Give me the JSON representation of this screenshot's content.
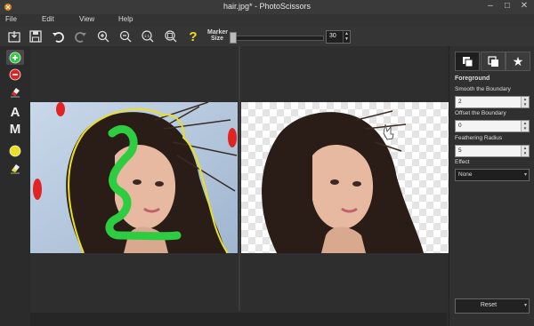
{
  "window": {
    "title": "hair.jpg* - PhotoScissors",
    "minimize": "–",
    "maximize": "□",
    "close": "✕"
  },
  "menu": [
    "File",
    "Edit",
    "View",
    "Help"
  ],
  "toolbar": {
    "icons": [
      "open-icon",
      "save-icon",
      "undo-icon",
      "redo-icon",
      "zoom-in-icon",
      "zoom-out-icon",
      "actual-size-icon",
      "fit-icon",
      "help-icon"
    ],
    "actual_size_label": "1:1",
    "help_label": "?",
    "marker_label_line1": "Marker",
    "marker_label_line2": "Size",
    "marker_size": "30",
    "marker_size_fraction": 0.0
  },
  "left_tools": {
    "items": [
      "foreground-marker-icon",
      "background-marker-icon",
      "eraser-icon",
      "text-tool-icon",
      "mask-tool-icon",
      "color-marker-icon",
      "color-eraser-icon"
    ],
    "text_letter": "A",
    "mask_letter": "M",
    "colors": {
      "green": "#2ecc40",
      "red": "#e02424",
      "yellow": "#e8e020"
    }
  },
  "panel": {
    "tab_icons": [
      "foreground-tab-icon",
      "background-tab-icon",
      "favorites-tab-icon"
    ],
    "section": "Foreground",
    "smooth_label": "Smooth the Boundary",
    "smooth_value": "2",
    "offset_label": "Offset the Boundary",
    "offset_value": "0",
    "feather_label": "Feathering Radius",
    "feather_value": "5",
    "effect_label": "Effect",
    "effect_value": "None",
    "reset_label": "Reset"
  },
  "colors": {
    "accent_green": "#2ecc40",
    "marker_red": "#e02424",
    "outline_yellow": "#e8e020"
  }
}
